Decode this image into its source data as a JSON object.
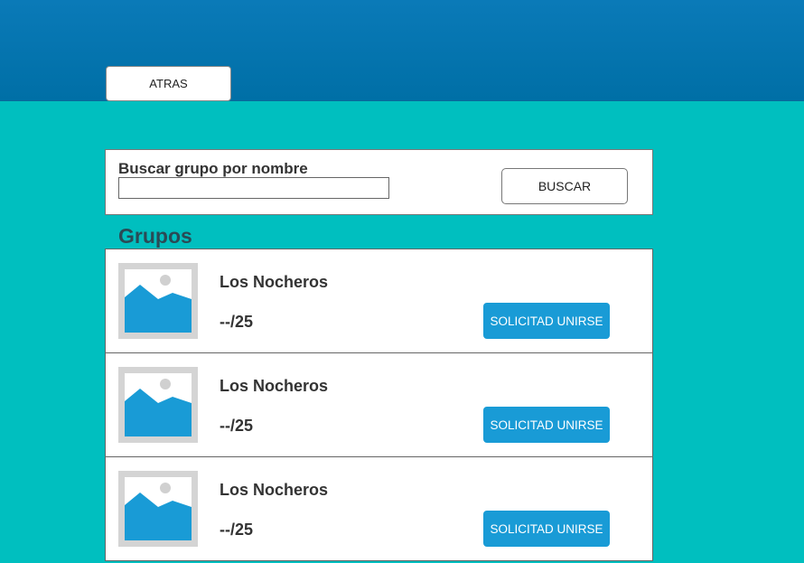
{
  "header": {
    "back_label": "ATRAS"
  },
  "search": {
    "label": "Buscar grupo por nombre",
    "value": "",
    "placeholder": "",
    "button_label": "BUSCAR"
  },
  "groups_section": {
    "title": "Grupos",
    "items": [
      {
        "name": "Los Nocheros",
        "count": "--/25",
        "action_label": "SOLICITAD UNIRSE",
        "thumbnail_icon": "image-placeholder-icon"
      },
      {
        "name": "Los Nocheros",
        "count": "--/25",
        "action_label": "SOLICITAD UNIRSE",
        "thumbnail_icon": "image-placeholder-icon"
      },
      {
        "name": "Los Nocheros",
        "count": "--/25",
        "action_label": "SOLICITAD UNIRSE",
        "thumbnail_icon": "image-placeholder-icon"
      }
    ]
  },
  "colors": {
    "page_background": "#00bfbf",
    "header_background": "#0077b0",
    "accent_button": "#199bd6",
    "thumbnail_frame": "#d4d4d4"
  }
}
